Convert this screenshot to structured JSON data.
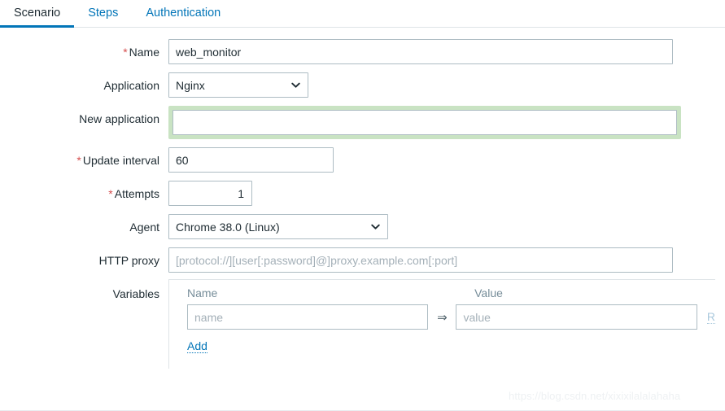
{
  "tabs": [
    {
      "label": "Scenario",
      "active": true
    },
    {
      "label": "Steps",
      "active": false
    },
    {
      "label": "Authentication",
      "active": false
    }
  ],
  "form": {
    "name": {
      "label": "Name",
      "required": true,
      "value": "web_monitor",
      "placeholder": ""
    },
    "application": {
      "label": "Application",
      "required": false,
      "value": "Nginx",
      "options": [
        "Nginx"
      ],
      "icon": "chevron-down-icon"
    },
    "new_application": {
      "label": "New application",
      "required": false,
      "value": "",
      "placeholder": "",
      "focused": true,
      "focus_color": "#c9e3c3"
    },
    "update_interval": {
      "label": "Update interval",
      "required": true,
      "value": "60",
      "placeholder": ""
    },
    "attempts": {
      "label": "Attempts",
      "required": true,
      "value": "1",
      "placeholder": ""
    },
    "agent": {
      "label": "Agent",
      "required": false,
      "value": "Chrome 38.0 (Linux)",
      "options": [
        "Chrome 38.0 (Linux)"
      ],
      "icon": "chevron-down-icon"
    },
    "http_proxy": {
      "label": "HTTP proxy",
      "required": false,
      "value": "",
      "placeholder": "[protocol://][user[:password]@]proxy.example.com[:port]"
    },
    "variables": {
      "label": "Variables",
      "columns": {
        "name": "Name",
        "value": "Value"
      },
      "arrow_glyph": "⇒",
      "rows": [
        {
          "name_value": "",
          "name_placeholder": "name",
          "value_value": "",
          "value_placeholder": "value",
          "remove_label": "R"
        }
      ],
      "add_label": "Add"
    }
  },
  "colors": {
    "accent": "#0275b8",
    "required_marker": "#d64f4f",
    "focus_ring": "#c9e3c3",
    "input_border": "#adbcc3",
    "muted_text": "#768d99"
  },
  "watermark": {
    "text": "https://blog.csdn.net/xixixilalalahaha"
  }
}
